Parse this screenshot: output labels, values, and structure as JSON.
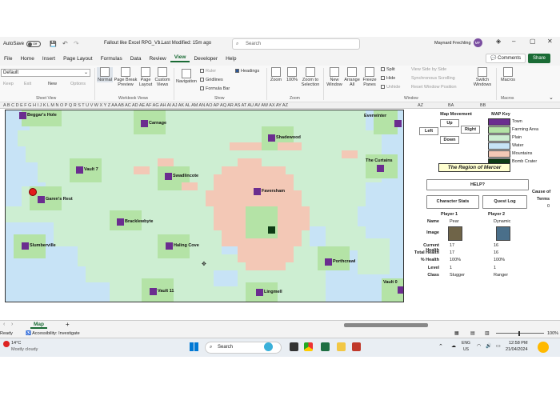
{
  "titlebar": {
    "autosave_label": "AutoSave",
    "autosave_state": "Off",
    "doc_title": "Fallout like Excel RPG_V1...",
    "modified": "• Last Modified: 15m ago",
    "search_placeholder": "Search",
    "user_name": "Maynard Frechling",
    "user_initials": "MF"
  },
  "menu": {
    "items": [
      "File",
      "Home",
      "Insert",
      "Page Layout",
      "Formulas",
      "Data",
      "Review",
      "View",
      "Developer",
      "Help"
    ],
    "active": "View",
    "comments_label": "Comments",
    "share_label": "Share"
  },
  "ribbon": {
    "sheet_view_value": "Default",
    "sheet_view_small": [
      "Keep",
      "Exit",
      "New",
      "Options"
    ],
    "sheet_view_group": "Sheet View",
    "workbook_views": [
      "Normal",
      "Page Break Preview",
      "Page Layout",
      "Custom Views"
    ],
    "workbook_group": "Workbook Views",
    "show": {
      "navigation": "Navigation",
      "ruler": "Ruler",
      "gridlines": "Gridlines",
      "formula_bar": "Formula Bar",
      "headings": "Headings"
    },
    "show_group": "Show",
    "zoom": [
      "Zoom",
      "100%",
      "Zoom to Selection"
    ],
    "zoom_group": "Zoom",
    "window": [
      "New Window",
      "Arrange All",
      "Freeze Panes",
      "Split",
      "Hide",
      "Unhide"
    ],
    "window_small": [
      "View Side by Side",
      "Synchronous Scrolling",
      "Reset Window Position"
    ],
    "switch_windows": "Switch Windows",
    "window_group": "Window",
    "macros": "Macros",
    "macros_group": "Macros"
  },
  "columns": "A  B  C  D  E  F  G  H  I  J  K  L  M  N  O  P  Q  R  S  T  U  V  W  X  Y  Z  AA AB AC AD AE AF AG AH AI AJ AK AL AM AN AO AP AQ AR AS AT AU AV AW AX AY AZ",
  "columns_right": [
    "AZ",
    "BA",
    "BB"
  ],
  "map": {
    "towns": [
      {
        "name": "Beggar's Hole"
      },
      {
        "name": "Carnage"
      },
      {
        "name": "Everwinter"
      },
      {
        "name": "Shadewood"
      },
      {
        "name": "Vault 7"
      },
      {
        "name": "Swadlincote"
      },
      {
        "name": "The Curtains"
      },
      {
        "name": "Faversham"
      },
      {
        "name": "Garen's Rest"
      },
      {
        "name": "Bracklewbyte"
      },
      {
        "name": "Slumberville"
      },
      {
        "name": "Haling Cove"
      },
      {
        "name": "Porthcrawl"
      },
      {
        "name": "Vault 11"
      },
      {
        "name": "Lingmell"
      },
      {
        "name": "Vault 0"
      }
    ],
    "colors": {
      "water": "#c7e3f6",
      "plain": "#cdeed2",
      "farming": "#b4e3a6",
      "mountain": "#f3c8b6",
      "town": "#6b2d8f",
      "bomb": "#0d3b14",
      "player": "#e31b1b"
    }
  },
  "panel": {
    "movement_title": "Map Movement",
    "up": "Up",
    "left": "Left",
    "right": "Right",
    "down": "Down",
    "key_title": "MAP Key",
    "key": [
      {
        "label": "Town",
        "color": "#6b2d8f"
      },
      {
        "label": "Farming Area",
        "color": "#b4e3a6"
      },
      {
        "label": "Plain",
        "color": "#cdeed2"
      },
      {
        "label": "Water",
        "color": "#c7e3f6"
      },
      {
        "label": "Mountains",
        "color": "#f3c8b6"
      },
      {
        "label": "Bomb Crater",
        "color": "#0d3b14"
      }
    ],
    "region_title": "The Region of Mercer",
    "help": "HELP?",
    "char_stats": "Character Stats",
    "quest_log": "Quest Log",
    "cause_label": "Cause of",
    "terms_label": "Terms",
    "terms_value": "0",
    "player1": "Player 1",
    "player2": "Player 2",
    "rows": [
      {
        "label": "Name",
        "p1": "Pear",
        "p2": "Dynamic"
      },
      {
        "label": "Image",
        "p1": "",
        "p2": ""
      },
      {
        "label": "Current Health",
        "p1": "17",
        "p2": "16"
      },
      {
        "label": "Total Health",
        "p1": "17",
        "p2": "16"
      },
      {
        "label": "% Health",
        "p1": "100%",
        "p2": "100%"
      },
      {
        "label": "Level",
        "p1": "1",
        "p2": "1"
      },
      {
        "label": "Class",
        "p1": "Slugger",
        "p2": "Ranger"
      }
    ]
  },
  "bottom": {
    "tab": "Map",
    "status_ready": "Ready",
    "accessibility": "Accessibility: Investigate",
    "zoom_pct": "100%"
  },
  "taskbar": {
    "weather_temp": "14°C",
    "weather_text": "Mostly cloudy",
    "search": "Search",
    "lang": "ENG",
    "region": "US",
    "time": "12:58 PM",
    "date": "21/04/2024"
  }
}
